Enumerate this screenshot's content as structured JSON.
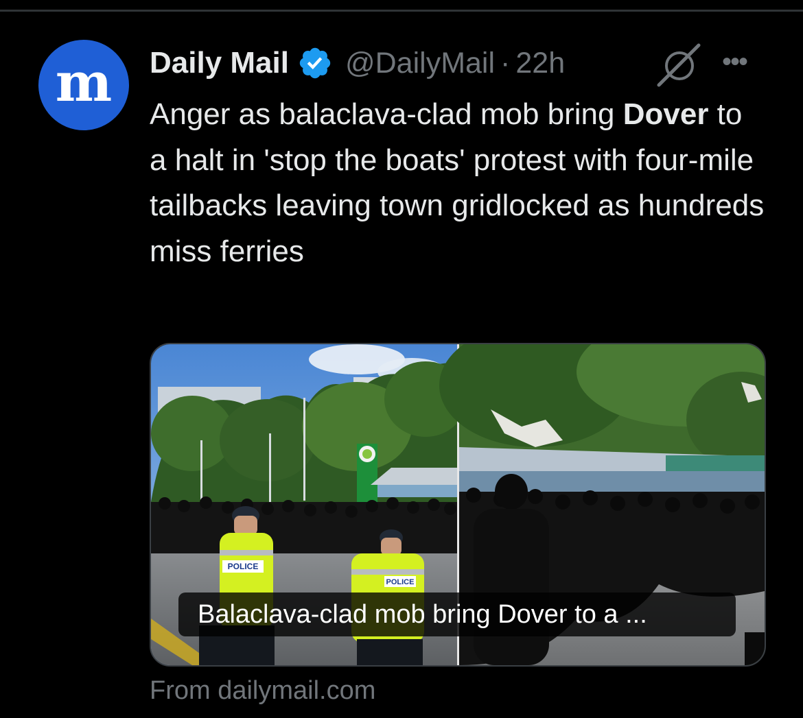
{
  "tweet": {
    "avatar_letter": "m",
    "display_name": "Daily Mail",
    "handle": "@DailyMail",
    "separator": "·",
    "time": "22h",
    "more_label": "•••",
    "text_before": "Anger as balaclava-clad mob bring ",
    "text_bold": "Dover",
    "text_after": " to a halt in 'stop the boats' protest with four-mile tailbacks leaving town gridlocked as hundreds miss ferries"
  },
  "card": {
    "caption": "Balaclava-clad mob bring Dover to a ...",
    "source": "From dailymail.com",
    "vest_label_1": "POLICE",
    "vest_label_2": "POLICE"
  },
  "icons": {
    "verified": "verified-badge-icon",
    "grok": "grok-icon",
    "more": "more-icon"
  },
  "colors": {
    "background": "#000000",
    "text_primary": "#e7e9ea",
    "text_secondary": "#71767b",
    "verified_blue": "#1d9bf0",
    "avatar_blue": "#1f5fd6"
  }
}
